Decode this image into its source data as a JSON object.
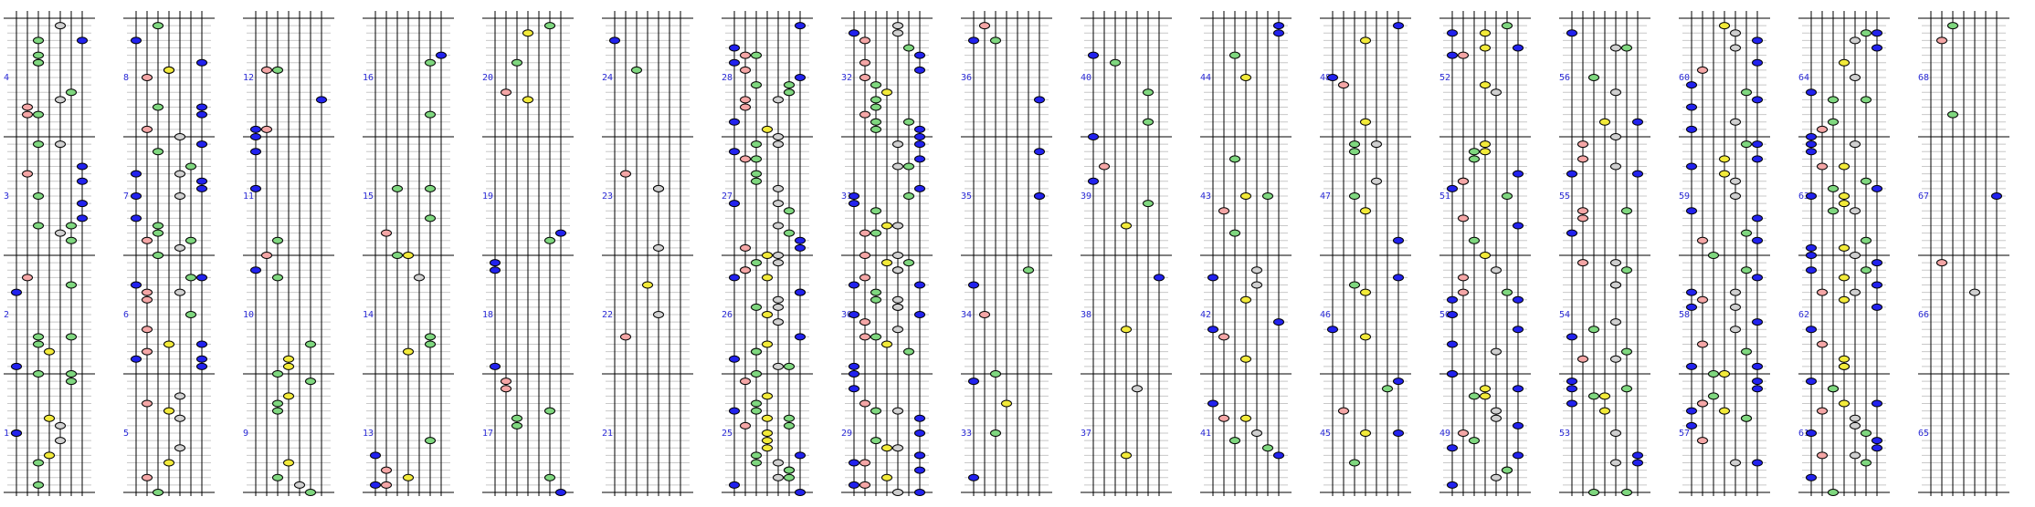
{
  "chart_data": {
    "type": "rhythm-chart",
    "lanes": 7,
    "measures_per_column": 4,
    "columns": 17,
    "colors": {
      "white": "#ffffff",
      "blue": "#2222ee",
      "red": "#f4a6a6",
      "green": "#7fd77f",
      "yellow": "#f2ea3a",
      "gray": "#cfcfcf",
      "lane": "#000000",
      "beat": "#c8c8c8",
      "number": "#2b2bd6"
    },
    "measure_numbers": [
      [
        "1",
        "2",
        "3",
        "4"
      ],
      [
        "5",
        "6",
        "7",
        "8"
      ],
      [
        "9",
        "10",
        "11",
        "12"
      ],
      [
        "13",
        "14",
        "15",
        "16"
      ],
      [
        "17",
        "18",
        "19",
        "20"
      ],
      [
        "21",
        "22",
        "23",
        "24"
      ],
      [
        "25",
        "26",
        "27",
        "28"
      ],
      [
        "29",
        "30",
        "31",
        "32"
      ],
      [
        "33",
        "34",
        "35",
        "36"
      ],
      [
        "37",
        "38",
        "39",
        "40"
      ],
      [
        "41",
        "42",
        "43",
        "44"
      ],
      [
        "45",
        "46",
        "47",
        "48"
      ],
      [
        "49",
        "50",
        "51",
        "52"
      ],
      [
        "53",
        "54",
        "55",
        "56"
      ],
      [
        "57",
        "58",
        "59",
        "60"
      ],
      [
        "61",
        "62",
        "63",
        "64"
      ],
      [
        "65",
        "66",
        "67",
        "68"
      ]
    ],
    "density": [
      0.55,
      0.55,
      0.25,
      0.2,
      0.35,
      0.3,
      0.9,
      0.85,
      0.2,
      0.2,
      0.35,
      0.3,
      0.55,
      0.55,
      0.55,
      0.55,
      0.05
    ]
  }
}
